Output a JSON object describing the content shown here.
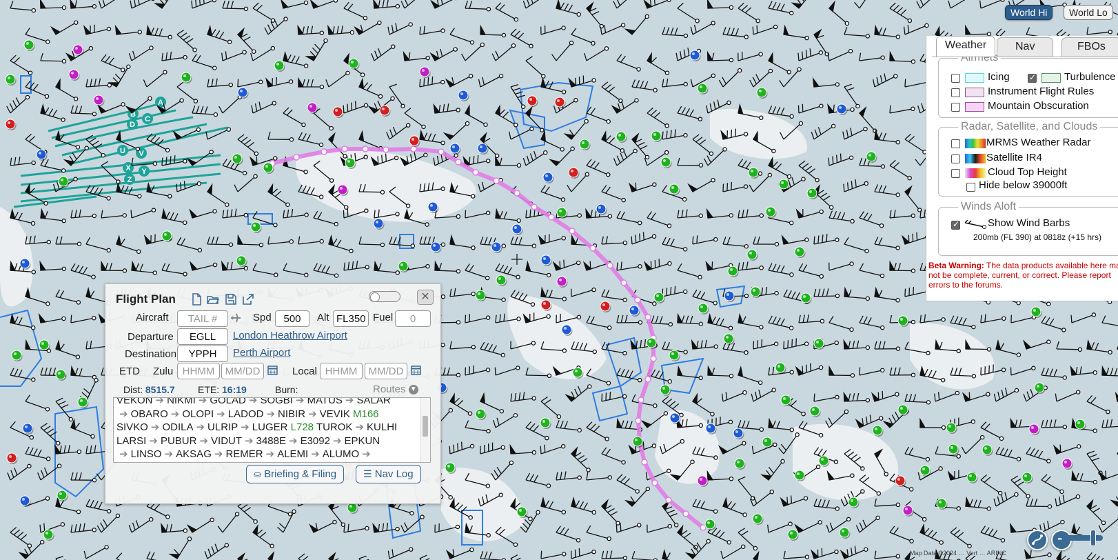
{
  "map": {
    "map_types": [
      "World Hi",
      "World Lo"
    ],
    "selected_map_type": "World Hi",
    "attribution": "Map Data ©2024 … Vert … ARINC",
    "colors": {
      "land": "#c9d8de",
      "water": "#edf2f4",
      "route": "#e27de6",
      "airmet_turbulence": "#1ea39a",
      "sigmet_outline": "#2e7de0",
      "vfr_green": "#1fb31f",
      "mvfr_blue": "#1f5bd6",
      "ifr_red": "#d21f1f",
      "lifr_magenta": "#c21fc6"
    },
    "airmet_labels": [
      "A",
      "B",
      "C",
      "D",
      "U",
      "V",
      "X",
      "Y",
      "Z"
    ]
  },
  "layers": {
    "tabs": [
      "Weather",
      "Nav",
      "FBOs"
    ],
    "active_tab": "Weather",
    "airmets": {
      "legend": "Airmets",
      "items": [
        {
          "label": "Icing",
          "checked": false
        },
        {
          "label": "Turbulence",
          "checked": true
        },
        {
          "label": "Instrument Flight Rules",
          "checked": false
        },
        {
          "label": "Mountain Obscuration",
          "checked": false
        }
      ]
    },
    "radar": {
      "legend": "Radar, Satellite, and Clouds",
      "items": [
        {
          "label": "MRMS Weather Radar",
          "checked": false
        },
        {
          "label": "Satellite IR4",
          "checked": false
        },
        {
          "label": "Cloud Top Height",
          "checked": false
        },
        {
          "label": "Hide below 39000ft",
          "checked": false
        }
      ]
    },
    "winds": {
      "legend": "Winds Aloft",
      "show_label": "Show Wind Barbs",
      "checked": true,
      "level_note": "200mb (FL 390) at 0818z (+15 hrs)"
    },
    "beta_title": "Beta Warning:",
    "beta_text": "The data products available here may not be complete, current, or correct. Please report errors to the forums."
  },
  "flight_plan": {
    "title": "Flight Plan",
    "aircraft_label": "Aircraft",
    "aircraft_placeholder": "TAIL #",
    "spd_label": "Spd",
    "spd_value": "500",
    "alt_label": "Alt",
    "alt_value": "FL350",
    "fuel_label": "Fuel",
    "fuel_placeholder": "0",
    "departure_label": "Departure",
    "departure_code": "EGLL",
    "departure_name": "London Heathrow Airport",
    "destination_label": "Destination",
    "destination_code": "YPPH",
    "destination_name": "Perth Airport",
    "etd_label": "ETD",
    "zulu_label": "Zulu",
    "local_label": "Local",
    "time_placeholder": "HHMM",
    "date_placeholder": "MM/DD",
    "dist_label": "Dist:",
    "dist_value": "8515.7",
    "ete_label": "ETE:",
    "ete_value": "16:19",
    "burn_label": "Burn:",
    "routes_label": "Routes",
    "route_lines": [
      [
        "VEKON",
        "NIKMI",
        "GOLAD",
        "SOGBI",
        "MATUS",
        "SALAR"
      ],
      [
        "",
        "OBARO",
        "OLOPI",
        "LADOD",
        "NIBIR",
        "VEVIK M166"
      ],
      [
        "SIVKO",
        "ODILA",
        "ULRIP",
        "LUGER L728 TUROK",
        "KULHI"
      ],
      [
        "LARSI",
        "PUBUR",
        "VIDUT",
        "3488E",
        "E3092",
        "EPKUN"
      ],
      [
        "",
        "LINSO",
        "AKSAG",
        "REMER",
        "ALEMI",
        "ALUMO",
        ""
      ]
    ],
    "briefing_button": "Briefing & Filing",
    "navlog_button": "Nav Log"
  }
}
